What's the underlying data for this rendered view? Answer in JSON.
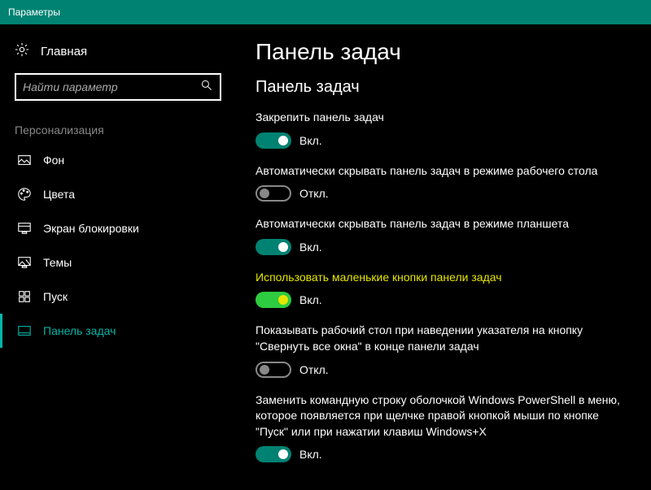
{
  "window": {
    "title": "Параметры"
  },
  "sidebar": {
    "home": "Главная",
    "search_placeholder": "Найти параметр",
    "section": "Персонализация",
    "items": [
      {
        "label": "Фон"
      },
      {
        "label": "Цвета"
      },
      {
        "label": "Экран блокировки"
      },
      {
        "label": "Темы"
      },
      {
        "label": "Пуск"
      },
      {
        "label": "Панель задач"
      }
    ]
  },
  "main": {
    "title": "Панель задач",
    "subtitle": "Панель задач",
    "settings": [
      {
        "label": "Закрепить панель задач",
        "state": "on",
        "state_text": "Вкл."
      },
      {
        "label": "Автоматически скрывать панель задач в режиме рабочего стола",
        "state": "off",
        "state_text": "Откл."
      },
      {
        "label": "Автоматически скрывать панель задач в режиме планшета",
        "state": "on",
        "state_text": "Вкл."
      },
      {
        "label": "Использовать маленькие кнопки панели задач",
        "state": "green",
        "state_text": "Вкл."
      },
      {
        "label": "Показывать рабочий стол при наведении указателя на кнопку \"Свернуть все окна\" в конце панели задач",
        "state": "off",
        "state_text": "Откл."
      },
      {
        "label": "Заменить командную строку оболочкой Windows PowerShell в меню, которое появляется при щелчке правой кнопкой мыши по кнопке \"Пуск\" или при нажатии клавиш Windows+X",
        "state": "on",
        "state_text": "Вкл."
      }
    ]
  }
}
